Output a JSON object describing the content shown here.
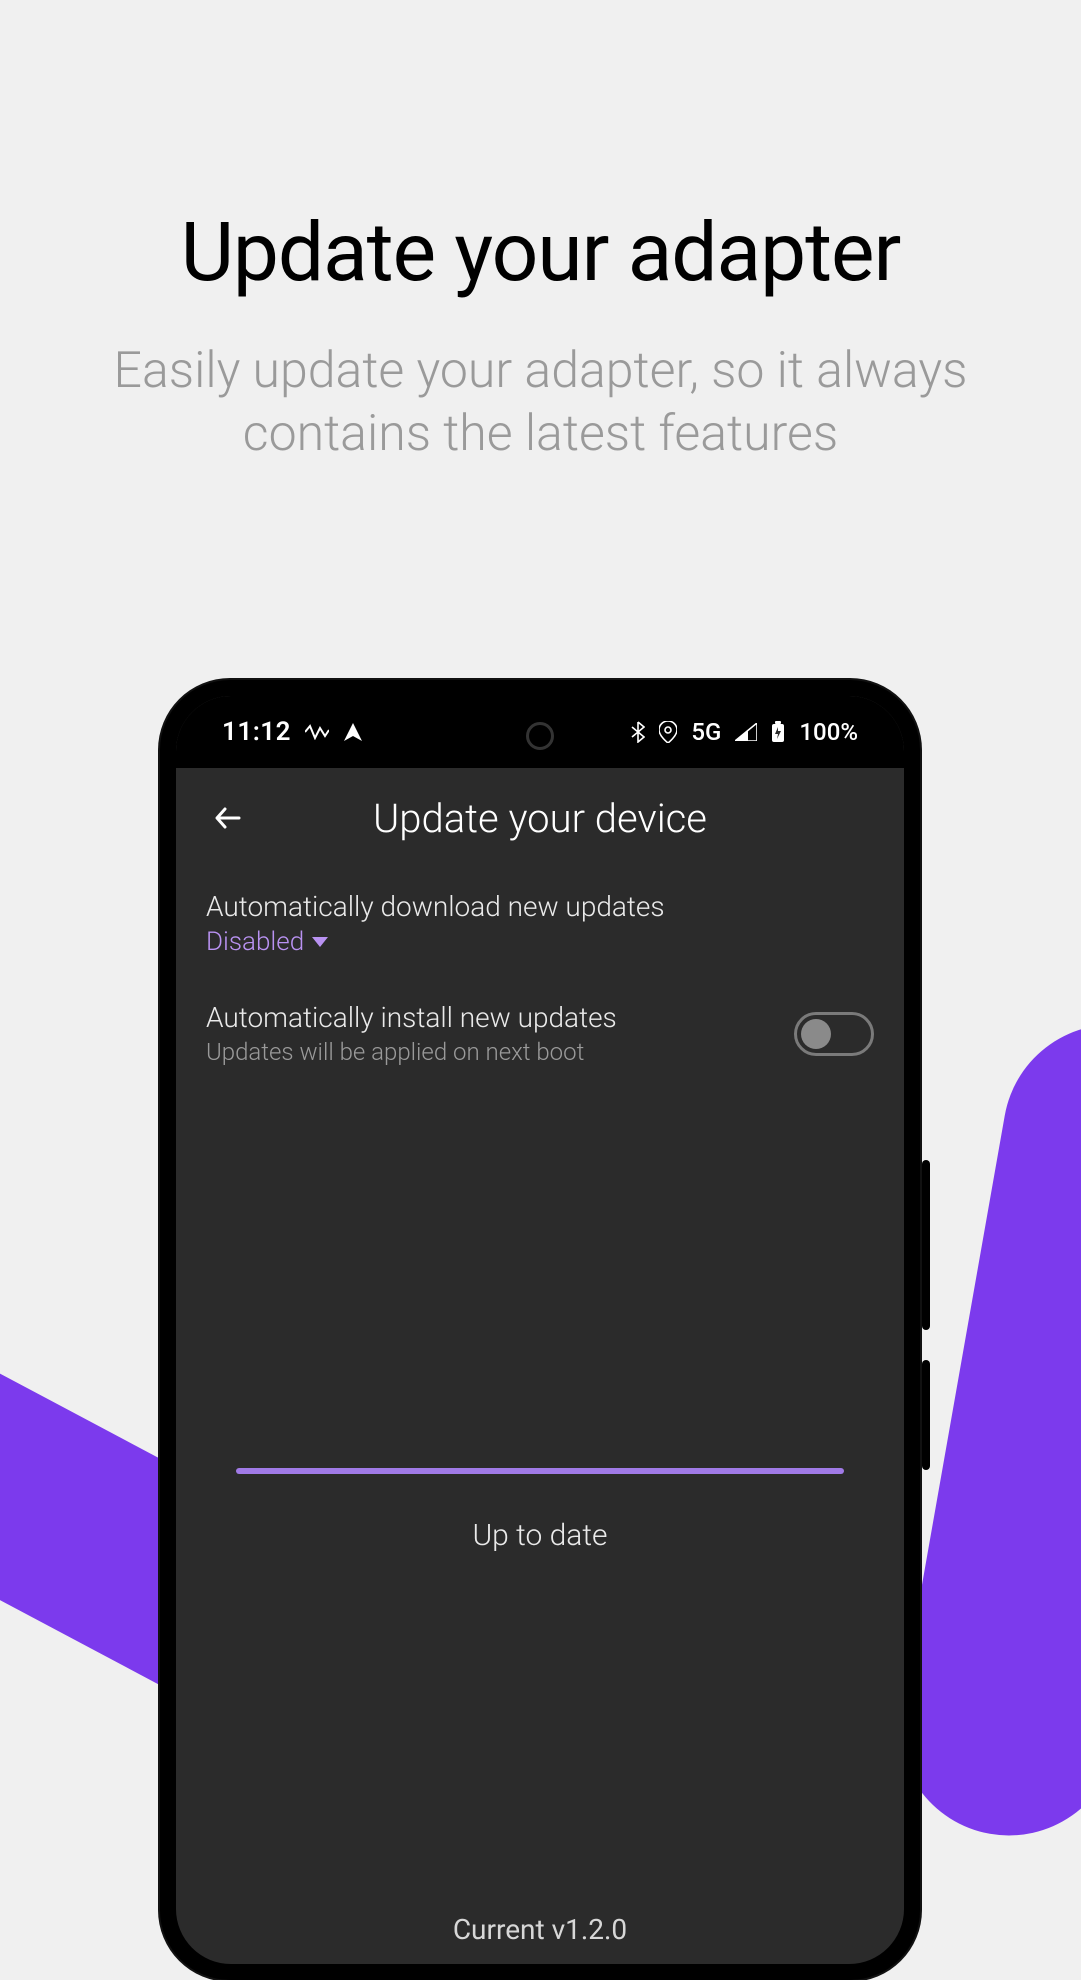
{
  "marketing": {
    "headline": "Update your adapter",
    "subhead": "Easily update your adapter, so it always contains the latest features"
  },
  "statusbar": {
    "time": "11:12",
    "network_label": "5G",
    "battery_pct": "100%"
  },
  "appbar": {
    "title": "Update your device"
  },
  "settings": {
    "auto_download": {
      "label": "Automatically download new updates",
      "value": "Disabled"
    },
    "auto_install": {
      "label": "Automatically install new updates",
      "sub": "Updates will be applied on next boot",
      "enabled": false
    }
  },
  "status": {
    "progress_pct": 100,
    "text": "Up to date",
    "version_label": "Current v1.2.0"
  },
  "colors": {
    "accent": "#7c3aed",
    "accent_light": "#b992f2",
    "screen_bg": "#2b2b2b"
  }
}
